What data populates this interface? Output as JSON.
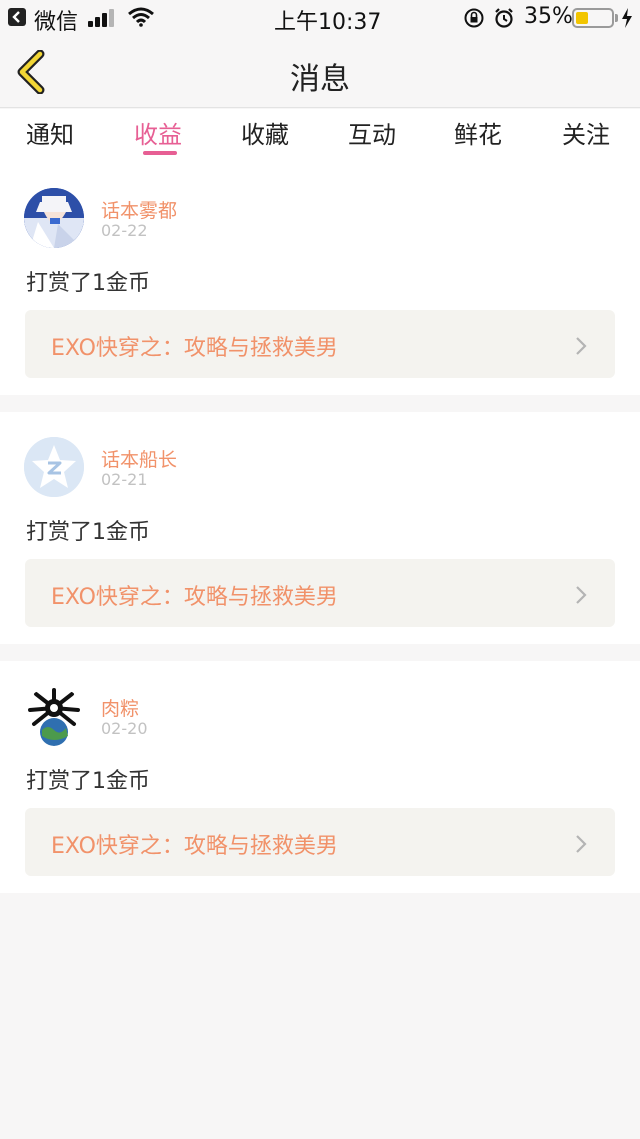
{
  "status_bar": {
    "app": "微信",
    "time": "上午10:37",
    "battery_percent": "35%",
    "battery_level": 0.35
  },
  "nav": {
    "title": "消息"
  },
  "tabs": [
    {
      "label": "通知",
      "active": false
    },
    {
      "label": "收益",
      "active": true
    },
    {
      "label": "收藏",
      "active": false
    },
    {
      "label": "互动",
      "active": false
    },
    {
      "label": "鲜花",
      "active": false
    },
    {
      "label": "关注",
      "active": false
    }
  ],
  "messages": [
    {
      "user": "话本雾都",
      "date": "02-22",
      "action": "打赏了1金币",
      "book": "EXO快穿之：攻略与拯救美男",
      "avatar": "anime-avatar"
    },
    {
      "user": "话本船长",
      "date": "02-21",
      "action": "打赏了1金币",
      "book": "EXO快穿之：攻略与拯救美男",
      "avatar": "default-star-avatar"
    },
    {
      "user": "肉粽",
      "date": "02-20",
      "action": "打赏了1金币",
      "book": "EXO快穿之：攻略与拯救美男",
      "avatar": "skull-globe-avatar"
    }
  ],
  "colors": {
    "accent": "#e75f94",
    "username": "#f1926a",
    "book": "#f1926a"
  }
}
